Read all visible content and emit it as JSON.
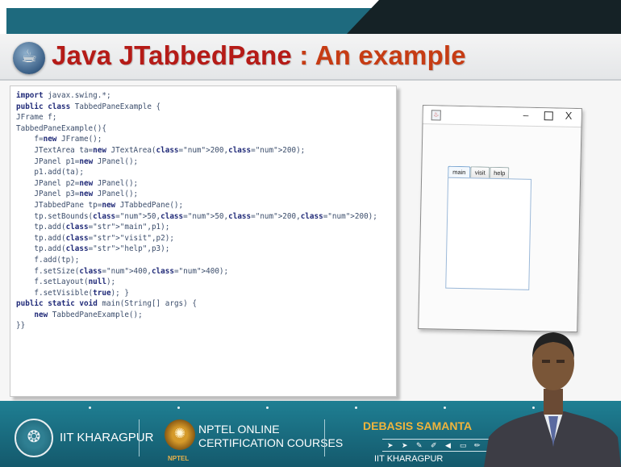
{
  "slide": {
    "title_part1": "Java JTabbedPane",
    "title_part2": " : An example",
    "logo_icon": "java-coffee-icon"
  },
  "code_lines": [
    "import javax.swing.*;",
    "public class TabbedPaneExample {",
    "JFrame f;",
    "TabbedPaneExample(){",
    "    f=new JFrame();",
    "    JTextArea ta=new JTextArea(200,200);",
    "    JPanel p1=new JPanel();",
    "    p1.add(ta);",
    "    JPanel p2=new JPanel();",
    "    JPanel p3=new JPanel();",
    "    JTabbedPane tp=new JTabbedPane();",
    "    tp.setBounds(50,50,200,200);",
    "    tp.add(\"main\",p1);",
    "    tp.add(\"visit\",p2);",
    "    tp.add(\"help\",p3);",
    "    f.add(tp);",
    "    f.setSize(400,400);",
    "    f.setLayout(null);",
    "    f.setVisible(true); }",
    "public static void main(String[] args) {",
    "    new TabbedPaneExample();",
    "}}"
  ],
  "demo_window": {
    "icon": "java-app-icon",
    "minimize": "–",
    "maximize": "☐",
    "close": "X",
    "tabs": [
      "main",
      "visit",
      "help"
    ],
    "selected_tab": "main"
  },
  "footer": {
    "institute": "IIT KHARAGPUR",
    "nptel_line1": "NPTEL ONLINE",
    "nptel_line2": "CERTIFICATION COURSES",
    "nptel_small": "NPTEL",
    "presenter": "DEBASIS SAMANTA",
    "presenter_institute": "IIT KHARAGPUR"
  },
  "colors": {
    "title_red": "#b51b17",
    "banner_teal": "#1e6a7e",
    "footer_teal": "#1a6e82",
    "presenter_gold": "#f0b43c"
  }
}
